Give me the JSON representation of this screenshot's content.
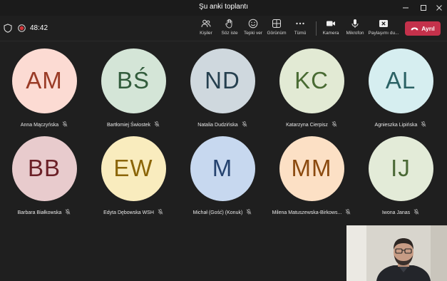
{
  "window": {
    "title": "Şu anki toplantı"
  },
  "toolbar": {
    "timer": "48:42",
    "buttons": [
      {
        "label": "Kişiler",
        "icon": "people-icon"
      },
      {
        "label": "Söz iste",
        "icon": "raise-hand-icon"
      },
      {
        "label": "Tepki ver",
        "icon": "smile-icon"
      },
      {
        "label": "Görünüm",
        "icon": "grid-view-icon"
      },
      {
        "label": "Tümü",
        "icon": "more-icon"
      },
      {
        "label": "Kamera",
        "icon": "camera-icon"
      },
      {
        "label": "Mikrofon",
        "icon": "microphone-icon"
      },
      {
        "label": "Paylaşımı du...",
        "icon": "stop-share-icon"
      }
    ],
    "leave_label": "Ayrıl",
    "leave_color": "#c4314b"
  },
  "participants": [
    {
      "initials": "AM",
      "name": "Anna Mączyńska",
      "bg": "#fcdbd3",
      "fg": "#9a3b26"
    },
    {
      "initials": "BŚ",
      "name": "Bartłomiej Świostek",
      "bg": "#d4e5d7",
      "fg": "#325c3c"
    },
    {
      "initials": "ND",
      "name": "Natalia Dudzińska",
      "bg": "#cfd8de",
      "fg": "#26404f"
    },
    {
      "initials": "KC",
      "name": "Katarzyna Cierpisz",
      "bg": "#e2ead4",
      "fg": "#496b33"
    },
    {
      "initials": "AL",
      "name": "Agnieszka Lipińska",
      "bg": "#d6eef0",
      "fg": "#2b6265"
    },
    {
      "initials": "BB",
      "name": "Barbara Białkowska",
      "bg": "#e8cbcd",
      "fg": "#6b2027"
    },
    {
      "initials": "EW",
      "name": "Edyta Dębowska WSH",
      "bg": "#f9ecbe",
      "fg": "#8b6508"
    },
    {
      "initials": "M",
      "name": "Michał (Gość) (Konuk)",
      "bg": "#c7d8ef",
      "fg": "#25436f"
    },
    {
      "initials": "MM",
      "name": "Milena Matuszewska-Birkows...",
      "bg": "#fce0c5",
      "fg": "#8b4a0f"
    },
    {
      "initials": "IJ",
      "name": "Iwona Janas",
      "bg": "#e3ebd8",
      "fg": "#4b6936"
    }
  ],
  "colors": {
    "background": "#1f1f1f",
    "muted_icon": "#b4b4b4"
  }
}
